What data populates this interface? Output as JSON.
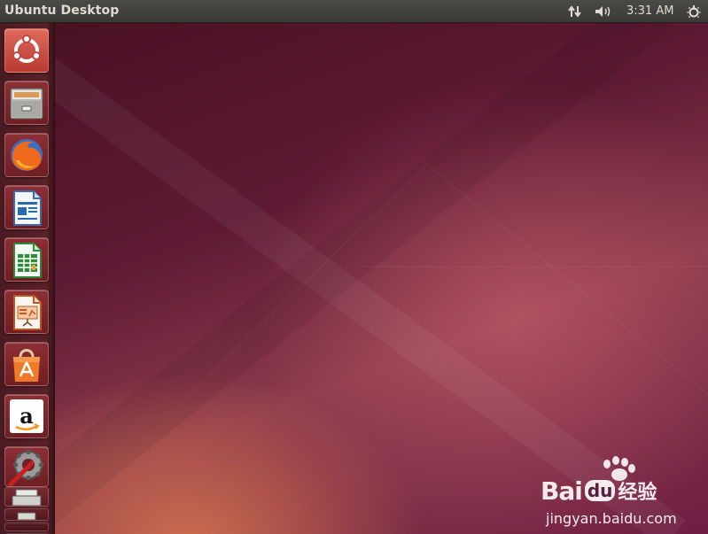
{
  "top_panel": {
    "title": "Ubuntu Desktop",
    "clock": "3:31 AM",
    "icons": [
      "network-updown-icon",
      "volume-icon",
      "session-gear-icon"
    ]
  },
  "launcher": {
    "items": [
      {
        "name": "dash-home",
        "icon": "ubuntu-logo-icon",
        "color": "#d84a3c"
      },
      {
        "name": "files",
        "icon": "file-cabinet-icon",
        "color": "#8a8a86"
      },
      {
        "name": "firefox",
        "icon": "firefox-icon",
        "color": "#e85d1c"
      },
      {
        "name": "libreoffice-writer",
        "icon": "writer-document-icon",
        "color": "#2a6ab0"
      },
      {
        "name": "libreoffice-calc",
        "icon": "calc-spreadsheet-icon",
        "color": "#2e8b3a"
      },
      {
        "name": "libreoffice-impress",
        "icon": "impress-presentation-icon",
        "color": "#c5561a"
      },
      {
        "name": "ubuntu-software-center",
        "icon": "shopping-bag-icon",
        "color": "#e8702a"
      },
      {
        "name": "amazon",
        "icon": "amazon-logo-icon",
        "color": "#ffffff"
      },
      {
        "name": "system-settings",
        "icon": "settings-wrench-icon",
        "color": "#8c8c8c"
      },
      {
        "name": "printer-stack",
        "icon": "printer-icon",
        "color": "#cfcfcf"
      }
    ]
  },
  "watermark": {
    "brand": "Bai",
    "brand_du": "du",
    "brand_cn": "经验",
    "url": "jingyan.baidu.com"
  }
}
